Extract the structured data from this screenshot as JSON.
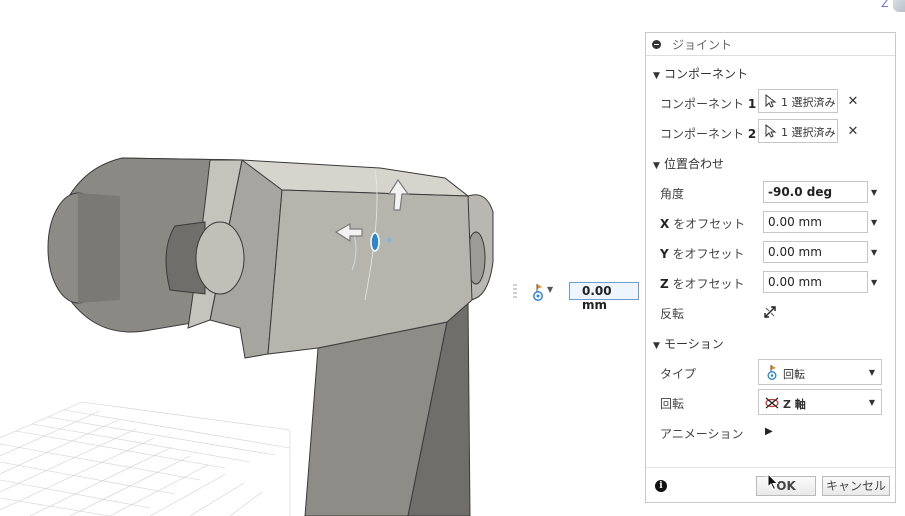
{
  "float_input": {
    "value": "0.00 mm"
  },
  "panel": {
    "title": "ジョイント",
    "component_section": "コンポーネント",
    "component1": {
      "label": "コンポーネント",
      "num": "1",
      "value": "1 選択済み"
    },
    "component2": {
      "label": "コンポーネント",
      "num": "2",
      "value": "1 選択済み"
    },
    "alignment_section": "位置合わせ",
    "angle": {
      "label": "角度",
      "value": "-90.0 deg"
    },
    "x_offset": {
      "axis": "X",
      "label": "をオフセット",
      "value": "0.00 mm"
    },
    "y_offset": {
      "axis": "Y",
      "label": "をオフセット",
      "value": "0.00 mm"
    },
    "z_offset": {
      "axis": "Z",
      "label": "をオフセット",
      "value": "0.00 mm"
    },
    "flip": {
      "label": "反転"
    },
    "motion_section": "モーション",
    "type": {
      "label": "タイプ",
      "value": "回転"
    },
    "rotation": {
      "label": "回転",
      "value": "Z 軸"
    },
    "animation": {
      "label": "アニメーション"
    },
    "ok_label": "OK",
    "cancel_label": "キャンセル"
  },
  "colors": {
    "accent": "#3a7fc1",
    "model_face": "#9a9993",
    "panel_border": "#c9c9c9"
  }
}
